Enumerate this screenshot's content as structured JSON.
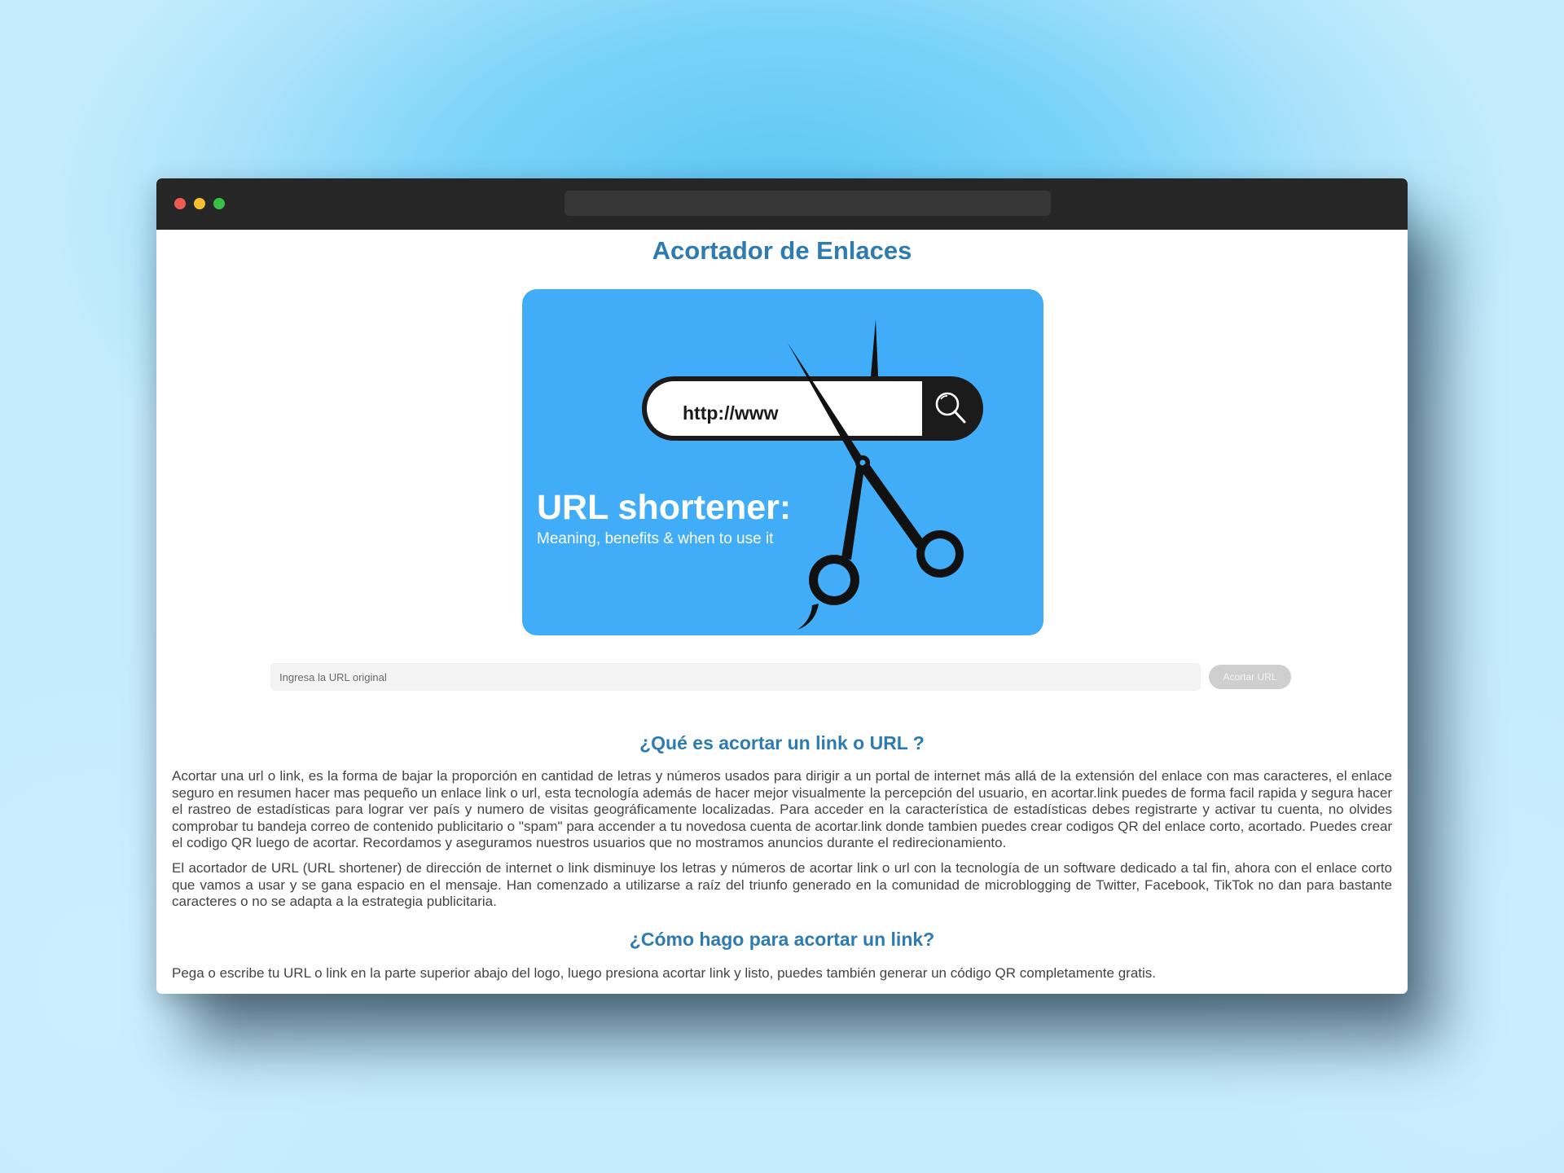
{
  "page": {
    "title": "Acortador de Enlaces"
  },
  "hero": {
    "url_text": "http://www",
    "headline": "URL shortener:",
    "subheadline": "Meaning, benefits & when to use it",
    "background_color": "#41acf7"
  },
  "form": {
    "url_placeholder": "Ingresa la URL original",
    "url_value": "",
    "submit_label": "Acortar URL"
  },
  "sections": [
    {
      "heading": "¿Qué es acortar un link o URL ?",
      "paragraphs": [
        "Acortar una url o link, es la forma de bajar la proporción en cantidad de letras y números usados para dirigir a un portal de internet más allá de la extensión del enlace con mas caracteres, el enlace seguro en resumen hacer mas pequeño un enlace link o url, esta tecnología además de hacer mejor visualmente la percepción del usuario, en acortar.link puedes de forma facil rapida y segura hacer el rastreo de estadísticas para lograr ver país y numero de visitas geográficamente localizadas. Para acceder en la característica de estadísticas debes registrarte y activar tu cuenta, no olvides comprobar tu bandeja correo de contenido publicitario o \"spam\" para accender a tu novedosa cuenta de acortar.link donde tambien puedes crear codigos QR del enlace corto, acortado. Puedes crear el codigo QR luego de acortar. Recordamos y aseguramos nuestros usuarios que no mostramos anuncios durante el redirecionamiento.",
        "El acortador de URL (URL shortener) de dirección de internet o link disminuye los letras y números de acortar link o url con la tecnología de un software dedicado a tal fin, ahora con el enlace corto que vamos a usar y se gana espacio en el mensaje. Han comenzado a utilizarse a raíz del triunfo generado en la comunidad de microblogging de Twitter, Facebook, TikTok no dan para bastante caracteres o no se adapta a la estrategia publicitaria."
      ]
    },
    {
      "heading": "¿Cómo hago para acortar un link?",
      "paragraphs": [
        "Pega o escribe tu URL o link en la parte superior abajo del logo, luego presiona acortar link y listo, puedes también generar un código QR completamente gratis."
      ]
    }
  ],
  "colors": {
    "accent": "#2d7bb0",
    "titlebar": "#262626",
    "button": "#cfcfcf",
    "text": "#444444"
  },
  "icons": {
    "search": "search-icon",
    "scissors": "scissors-icon"
  }
}
